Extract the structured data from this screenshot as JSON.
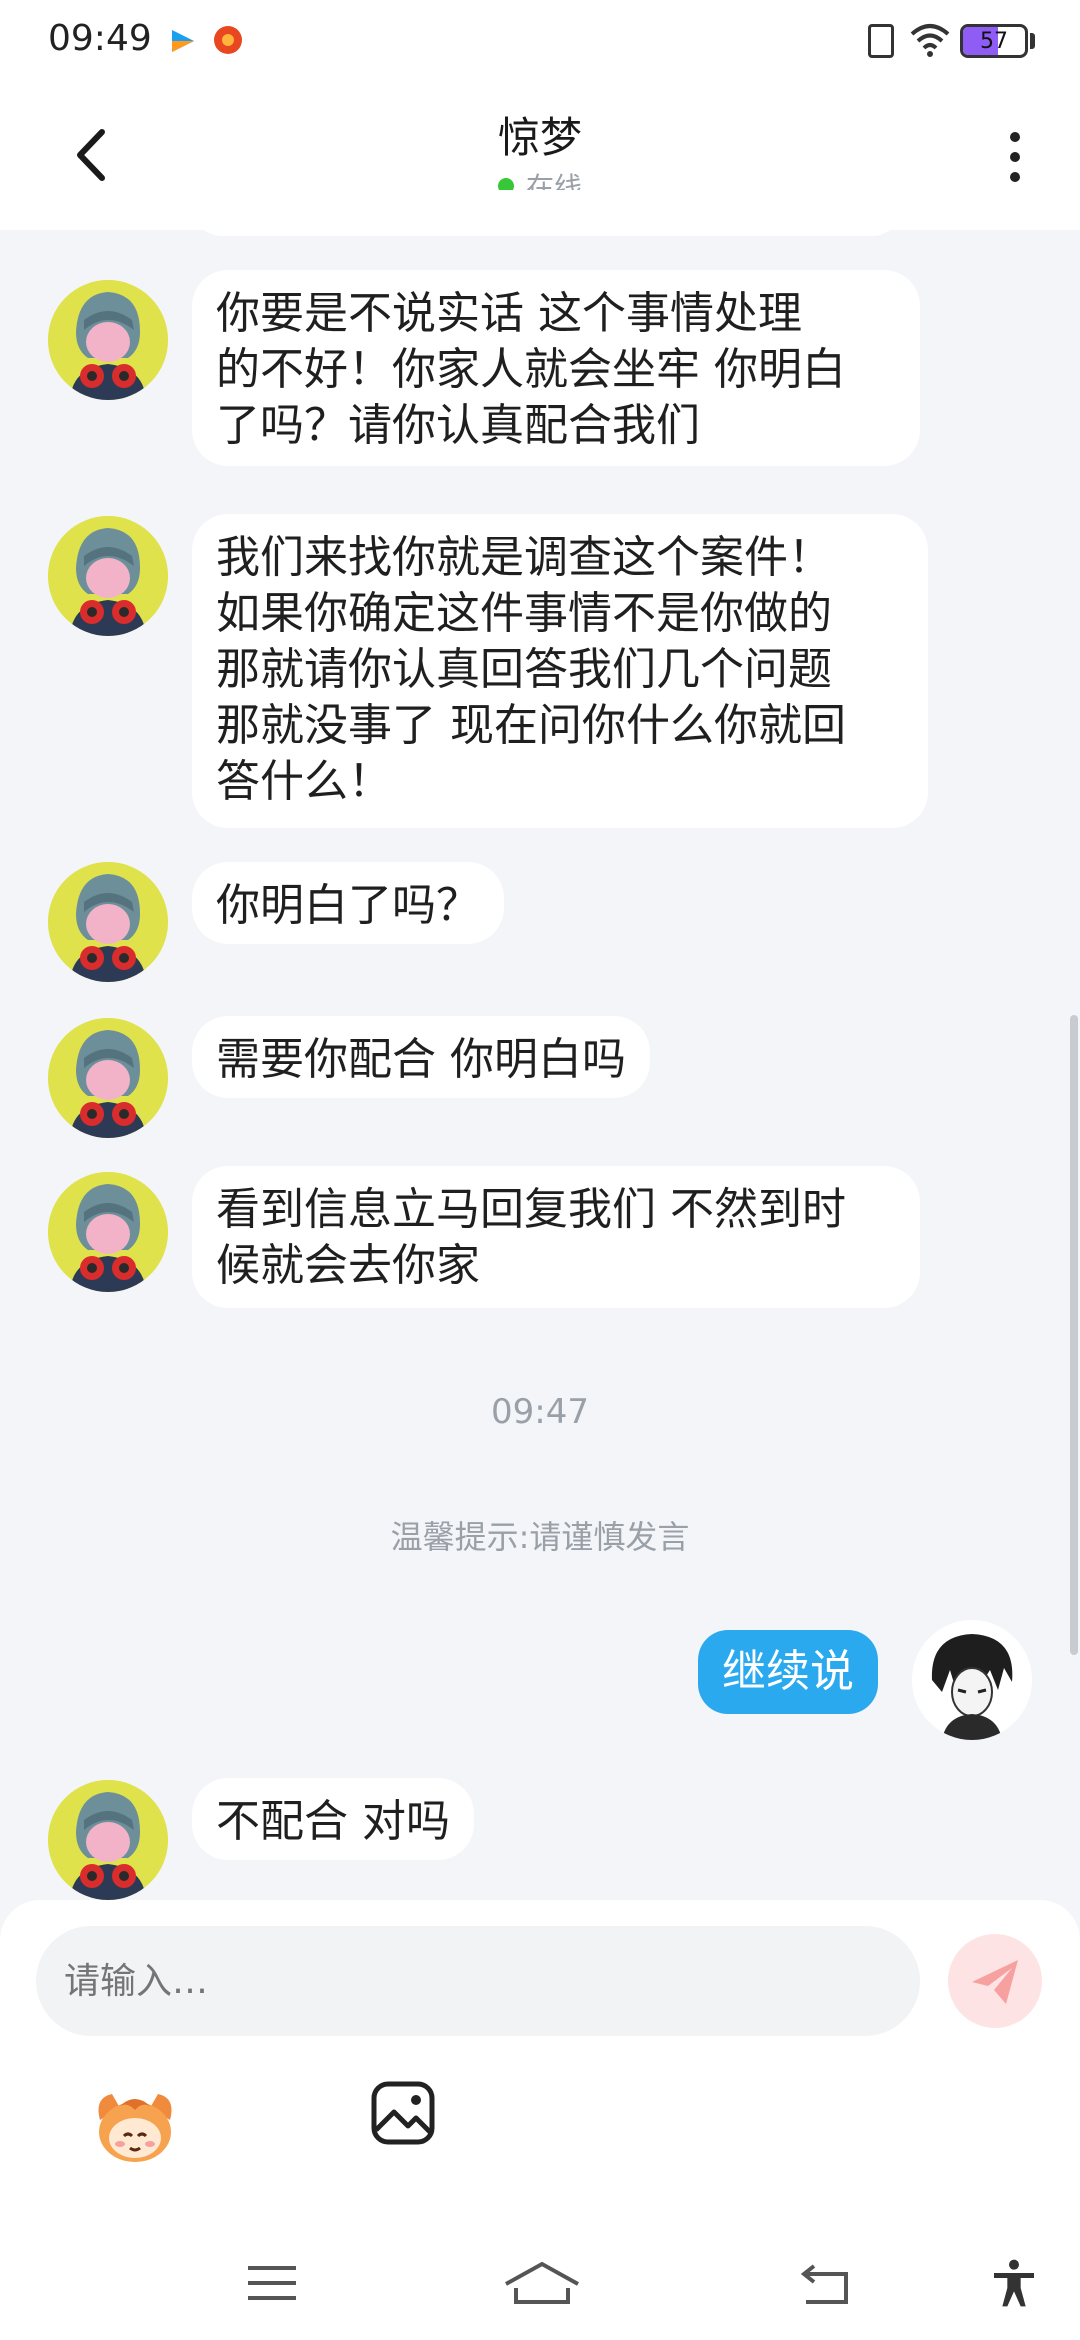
{
  "status_bar": {
    "time": "09:49",
    "battery": "57",
    "battery_level": 0.57
  },
  "header": {
    "title": "惊梦",
    "online_status": "在线"
  },
  "messages": [
    {
      "from": "other",
      "lines": [
        "你要是不说实话  这个事情处理",
        "的不好！你家人就会坐牢 你明白",
        "了吗？请你认真配合我们"
      ]
    },
    {
      "from": "other",
      "lines": [
        "我们来找你就是调查这个案件！",
        "如果你确定这件事情不是你做的",
        "那就请你认真回答我们几个问题",
        "那就没事了 现在问你什么你就回",
        "答什么！"
      ]
    },
    {
      "from": "other",
      "lines": [
        "你明白了吗？"
      ]
    },
    {
      "from": "other",
      "lines": [
        "需要你配合 你明白吗"
      ]
    },
    {
      "from": "other",
      "lines": [
        "看到信息立马回复我们 不然到时",
        "候就会去你家"
      ]
    },
    {
      "from": "me",
      "lines": [
        "继续说"
      ]
    },
    {
      "from": "other",
      "lines": [
        "不配合 对吗"
      ]
    }
  ],
  "timestamp": "09:47",
  "tip": "温馨提示:请谨慎发言",
  "composer": {
    "placeholder": "请输入…"
  },
  "icons": {
    "back": "back-arrow-icon",
    "more": "more-dots-icon",
    "send": "send-icon",
    "emoji": "emoji-mascot-icon",
    "image": "image-icon",
    "accent_color": "#2aa9ee"
  }
}
